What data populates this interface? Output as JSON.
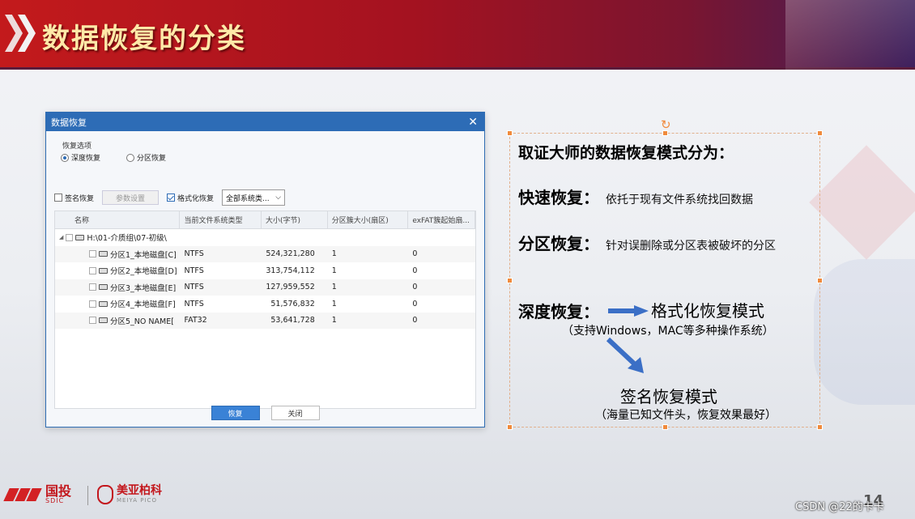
{
  "slide": {
    "title": "数据恢复的分类",
    "page_number": "14",
    "watermark": "CSDN @22的卡卡"
  },
  "dialog": {
    "title": "数据恢复",
    "close_icon": "close-icon",
    "group_label": "恢复选项",
    "radios": [
      {
        "label": "深度恢复",
        "checked": true
      },
      {
        "label": "分区恢复",
        "checked": false
      }
    ],
    "options": {
      "signature_label": "签名恢复",
      "signature_checked": false,
      "param_button": "参数设置",
      "format_label": "格式化恢复",
      "format_checked": true,
      "fs_select": "全部系统类..."
    },
    "table": {
      "headers": [
        "名称",
        "当前文件系统类型",
        "大小(字节)",
        "分区簇大小(扇区)",
        "exFAT簇起始扇..."
      ],
      "root": "H:\\01-介质组\\07-初级\\",
      "rows": [
        {
          "name": "分区1_本地磁盘[C]",
          "fs": "NTFS",
          "size": "524,321,280",
          "cluster": "1",
          "exfat": "0"
        },
        {
          "name": "分区2_本地磁盘[D]",
          "fs": "NTFS",
          "size": "313,754,112",
          "cluster": "1",
          "exfat": "0"
        },
        {
          "name": "分区3_本地磁盘[E]",
          "fs": "NTFS",
          "size": "127,959,552",
          "cluster": "1",
          "exfat": "0"
        },
        {
          "name": "分区4_本地磁盘[F]",
          "fs": "NTFS",
          "size": "51,576,832",
          "cluster": "1",
          "exfat": "0"
        },
        {
          "name": "分区5_NO NAME[",
          "fs": "FAT32",
          "size": "53,641,728",
          "cluster": "1",
          "exfat": "0"
        }
      ]
    },
    "buttons": {
      "recover": "恢复",
      "close": "关闭"
    }
  },
  "textbox": {
    "heading": "取证大师的数据恢复模式分为：",
    "quick_key": "快速恢复：",
    "quick_desc": "依托于现有文件系统找回数据",
    "partition_key": "分区恢复：",
    "partition_desc": "针对误删除或分区表被破坏的分区",
    "deep_key": "深度恢复：",
    "mode1": "格式化恢复模式",
    "mode1_note": "（支持Windows，MAC等多种操作系统）",
    "mode2": "签名恢复模式",
    "mode2_note": "（海量已知文件头，恢复效果最好）"
  },
  "footer": {
    "logo1_main": "国投",
    "logo1_sub": "SDIC",
    "logo2_main": "美亚柏科",
    "logo2_sub": "MEIYA PICO"
  },
  "colors": {
    "accent_red": "#c31a1c",
    "title_gold": "#ffe9a8",
    "dialog_blue": "#2d6cb6",
    "handle_orange": "#f08a3c"
  }
}
